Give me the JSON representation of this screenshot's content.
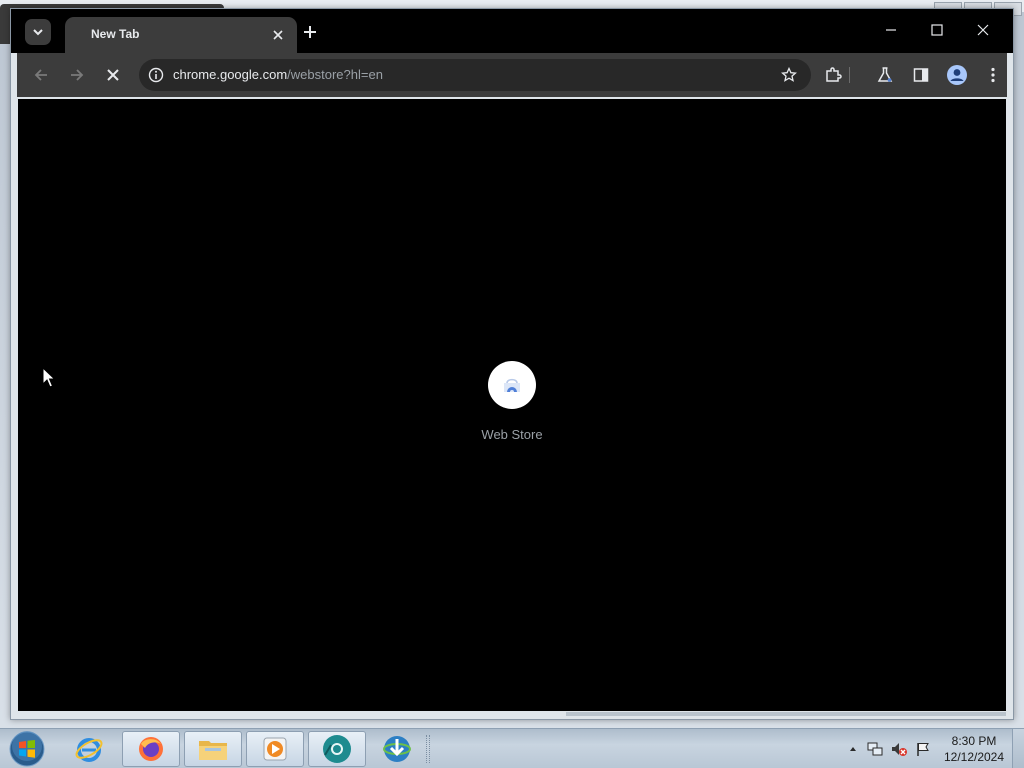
{
  "browser": {
    "tab": {
      "title": "New Tab",
      "close_icon": "close-icon"
    },
    "new_tab_icon": "plus-icon",
    "tab_search_icon": "chevron-down-icon",
    "window_controls": [
      "minimize-icon",
      "maximize-icon",
      "close-icon"
    ],
    "toolbar": {
      "back_icon": "arrow-left-icon",
      "forward_icon": "arrow-right-icon",
      "stop_icon": "stop-icon",
      "address": {
        "host": "chrome.google.com",
        "path": "/webstore?hl=en"
      },
      "star_icon": "star-icon",
      "extensions_icon": "puzzle-icon",
      "labs_icon": "flask-icon",
      "side_panel_icon": "side-panel-icon",
      "profile_icon": "profile-icon",
      "menu_icon": "kebab-menu-icon"
    },
    "content": {
      "splash_label": "Web Store",
      "background": "#000000"
    }
  },
  "taskbar": {
    "apps": [
      "internet-explorer-icon",
      "firefox-icon",
      "file-explorer-icon",
      "media-player-icon",
      "chrome-icon",
      "download-manager-icon"
    ],
    "clock": {
      "time": "8:30 PM",
      "date": "12/12/2024"
    }
  },
  "colors": {
    "titlebar": "#000000",
    "toolbar": "#3c3c3c",
    "omnibox": "#282828",
    "accent_blue": "#4f7fd8"
  }
}
